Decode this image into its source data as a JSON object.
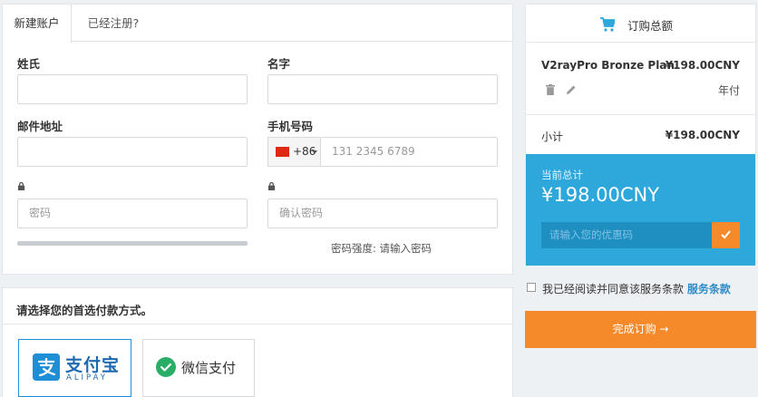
{
  "tabs": {
    "new_account": "新建账户",
    "already_registered": "已经注册?"
  },
  "form": {
    "surname_label": "姓氏",
    "given_name_label": "名字",
    "email_label": "邮件地址",
    "phone_label": "手机号码",
    "phone_code": "+86",
    "phone_placeholder": "131 2345 6789",
    "password_placeholder": "密码",
    "confirm_password_placeholder": "确认密码",
    "strength_text": "密码强度: 请输入密码"
  },
  "payment": {
    "title": "请选择您的首选付款方式。",
    "alipay_label": "支付宝",
    "alipay_sub": "ALIPAY",
    "wechat_label": "微信支付"
  },
  "summary": {
    "title": "订购总额",
    "product_name": "V2rayPro Bronze Plan",
    "product_price": "¥198.00CNY",
    "billing_cycle": "年付",
    "subtotal_label": "小计",
    "subtotal_value": "¥198.00CNY",
    "total_label": "当前总计",
    "total_value": "¥198.00CNY",
    "promo_placeholder": "请输入您的优惠码"
  },
  "terms": {
    "text": "我已经阅读并同意该服务条款",
    "link": "服务条款"
  },
  "checkout_button": "完成订购 →",
  "colors": {
    "accent_blue": "#2ea7db",
    "accent_orange": "#f58a2a",
    "alipay_blue": "#1e8fd6",
    "wechat_green": "#2aae67"
  }
}
